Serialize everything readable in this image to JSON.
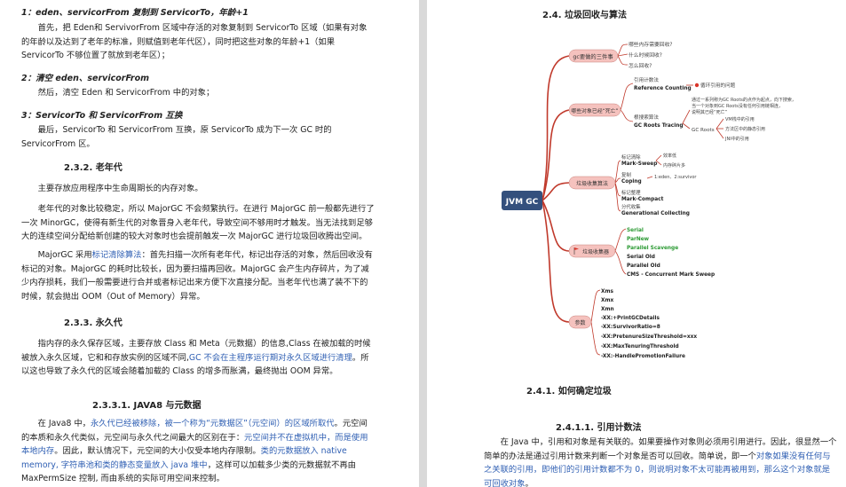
{
  "left": {
    "step1_heading": "1：eden、servicorFrom 复制到 ServicorTo，年龄+1",
    "step1_text": "首先，把 Eden和 ServivorFrom 区域中存活的对象复制到 ServicorTo 区域（如果有对象的年龄以及达到了老年的标准，则赋值到老年代区），同时把这些对象的年龄+1（如果 ServicorTo 不够位置了就放到老年区）；",
    "step2_heading": "2：清空 eden、servicorFrom",
    "step2_text": "然后，清空 Eden 和 ServicorFrom 中的对象；",
    "step3_heading": "3：ServicorTo 和 ServicorFrom 互换",
    "step3_text": "最后，ServicorTo 和 ServicorFrom 互换，原 ServicorTo 成为下一次 GC 时的 ServicorFrom 区。",
    "sec_old_title": "2.3.2.  老年代",
    "old_p1": "主要存放应用程序中生命周期长的内存对象。",
    "old_p2": "老年代的对象比较稳定，所以 MajorGC 不会频繁执行。在进行 MajorGC 前一般都先进行了一次 MinorGC，使得有新生代的对象晋身入老年代，导致空间不够用时才触发。当无法找到足够大的连续空间分配给新创建的较大对象时也会提前触发一次 MajorGC 进行垃圾回收腾出空间。",
    "old_p3_a": "MajorGC 采用",
    "old_p3_link": "标记清除算法",
    "old_p3_b": "：首先扫描一次所有老年代，标记出存活的对象，然后回收没有标记的对象。MajorGC 的耗时比较长，因为要扫描再回收。MajorGC 会产生内存碎片，为了减少内存损耗，我们一般需要进行合并或者标记出来方便下次直接分配。当老年代也满了装不下的时候，就会抛出 OOM（Out of Memory）异常。",
    "sec_perm_title": "2.3.3.  永久代",
    "perm_p1_a": "指内存的永久保存区域，主要存放 Class 和 Meta（元数据）的信息,Class 在被加载的时候被放入永久区域，它和和存放实例的区域不同,",
    "perm_p1_link": "GC 不会在主程序运行期对永久区域进行清理",
    "perm_p1_b": "。所以这也导致了永久代的区域会随着加载的 Class 的增多而胀满，最终抛出 OOM 异常。",
    "sec_j8_title": "2.3.3.1.     JAVA8 与元数据",
    "j8_p1_a": "在 Java8 中，",
    "j8_p1_link1": "永久代已经被移除，被一个称为“元数据区”（元空间）的区域所取代",
    "j8_p1_b": "。元空间的本质和永久代类似，元空间与永久代之间最大的区别在于：",
    "j8_p1_link2": "元空间并不在虚拟机中，而是使用本地内存",
    "j8_p1_c": "。因此，默认情况下，元空间的大小仅受本地内存限制。",
    "j8_p1_link3": "类的元数据放入 native memory, 字符串池和类的静态变量放入 java 堆中",
    "j8_p1_d": "，这样可以加载多少类的元数据就不再由 MaxPermSize 控制, 而由系统的实际可用空间来控制。"
  },
  "right": {
    "sec_title": "2.4.  垃圾回收与算法",
    "mindmap": {
      "root": "JVM GC",
      "three_q": {
        "label": "gc要做的三件事",
        "items": [
          "哪些内存需要回收?",
          "什么时候回收?",
          "怎么回收?"
        ]
      },
      "dead": {
        "label": "哪些对象已经“死亡”",
        "rc_title": "引用计数法",
        "rc_name": "Reference Counting",
        "rc_note": "循环引用的问题",
        "reach_title": "根搜索算法",
        "reach_name": "GC Roots Tracing",
        "reach_note": [
          "通过一系列称为GC Roots的点作为起点，向下搜索，",
          "当一个对象到GC Roots没有任何引用链相连，",
          "说明其已经“死亡”"
        ],
        "gcroots_label": "GC Roots",
        "gcroots_items": [
          "VM栈中的引用",
          "方法区中的静态引用",
          "JNI中的引用"
        ]
      },
      "algo": {
        "label": "垃圾收集算法",
        "ms_title": "标记清除",
        "ms_name": "Mark-Sweep",
        "ms_notes": [
          "效率低",
          "内存碎片多"
        ],
        "cp_title": "复制",
        "cp_name": "Coping",
        "cp_note": "1:eden、2:survivor",
        "mc_title": "标记整理",
        "mc_name": "Mark-Compact",
        "gen_title": "分代收集",
        "gen_name": "Generational Collecting"
      },
      "collectors": {
        "label": "垃圾收集器",
        "items": [
          "Serial",
          "ParNew",
          "Parallel Scavenge",
          "Serial Old",
          "Parallel Old",
          "CMS - Concurrent Mark Sweep"
        ]
      },
      "params": {
        "label": "参数",
        "items": [
          "Xms",
          "Xmx",
          "Xmn",
          "-XX:+PrintGCDetails",
          "-XX:SurvivorRatio=8",
          "-XX:PretenureSizeThreshold=xxx",
          "-XX:MaxTenuringThreshold",
          "-XX:-HandlePromotionFailure"
        ]
      }
    },
    "sub_title": "2.4.1.  如何确定垃圾",
    "rc_title": "2.4.1.1.     引用计数法",
    "rc_p_a": "在 Java 中，引用和对象是有关联的。如果要操作对象则必须用引用进行。因此，很显然一个简单的办法是通过引用计数来判断一个对象是否可以回收。简单说，即一个",
    "rc_p_link": "对象如果没有任何与之关联的引用，即他们的引用计数都不为 0，则说明对象不太可能再被用到，那么这个对象就是可回收对象",
    "rc_p_b": "。"
  },
  "colors": {
    "link_blue": "#2f5fb3",
    "branch_red": "#c0392b",
    "node_pink": "#f5c2be",
    "root_navy": "#34507d",
    "collector_green": "#2b9a33"
  }
}
